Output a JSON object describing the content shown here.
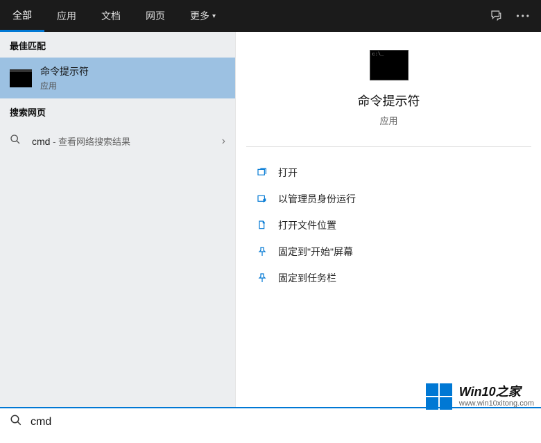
{
  "topbar": {
    "tabs": {
      "all": "全部",
      "apps": "应用",
      "docs": "文档",
      "web": "网页",
      "more": "更多"
    }
  },
  "left": {
    "best_match_header": "最佳匹配",
    "result": {
      "title": "命令提示符",
      "subtitle": "应用"
    },
    "web_header": "搜索网页",
    "web_item": {
      "query": "cmd",
      "hint": " - 查看网络搜索结果"
    }
  },
  "right": {
    "preview_title": "命令提示符",
    "preview_sub": "应用",
    "actions": {
      "open": "打开",
      "run_admin": "以管理员身份运行",
      "open_location": "打开文件位置",
      "pin_start": "固定到\"开始\"屏幕",
      "pin_taskbar": "固定到任务栏"
    }
  },
  "search": {
    "value": "cmd"
  },
  "watermark": {
    "title": "Win10之家",
    "url": "www.win10xitong.com"
  }
}
